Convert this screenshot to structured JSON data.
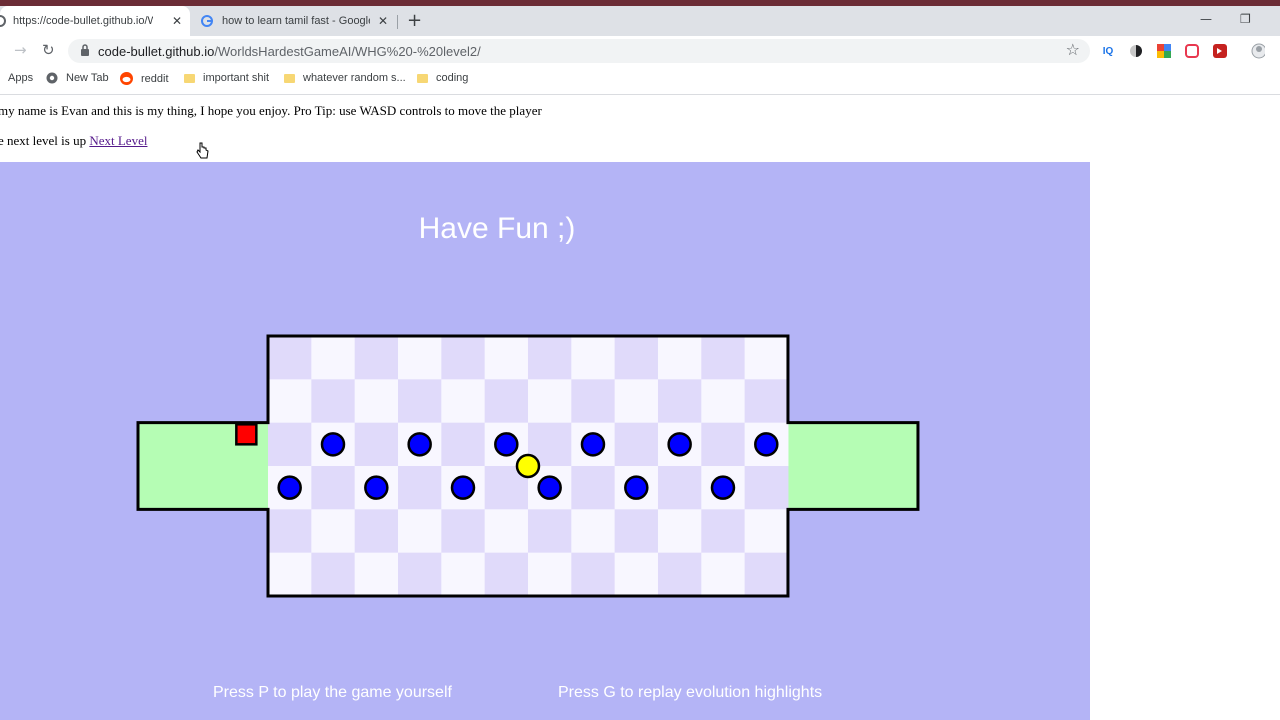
{
  "browser": {
    "tabs": [
      {
        "title": "https://code-bullet.github.io/Wo",
        "active": true
      },
      {
        "title": "how to learn tamil fast - Google",
        "active": false
      }
    ],
    "address": {
      "host": "code-bullet.github.io",
      "path": "/WorldsHardestGameAI/WHG%20-%20level2/"
    },
    "bookmarks": [
      "Apps",
      "New Tab",
      "reddit",
      "important shit",
      "whatever random s...",
      "coding"
    ],
    "extensions": [
      "IQ",
      "half-moon-icon",
      "colorful-grid-icon",
      "pocket-icon",
      "red-extension-icon",
      "profile-icon"
    ]
  },
  "page": {
    "intro": "my name is Evan and this is my thing, I hope you enjoy. Pro Tip: use WASD controls to move the player",
    "next_prefix": "e next level is up ",
    "next_link": "Next Level"
  },
  "game": {
    "headline": "Have Fun ;)",
    "hint_left": "Press P to play the game yourself",
    "hint_right": "Press G to replay evolution highlights",
    "colors": {
      "background": "#b4b4f6",
      "tile_light": "#f8f7ff",
      "tile_dark": "#e0dafa",
      "safe_zone": "#b5fdb4",
      "player": "#ff0000",
      "enemy": "#0000ff",
      "coin": "#ffff00"
    },
    "grid": {
      "cols": 12,
      "rows": 6
    },
    "safe_zones": [
      "start",
      "end"
    ],
    "player": {
      "col": -1,
      "row": 2
    },
    "enemies": [
      {
        "col": 1,
        "row": 2
      },
      {
        "col": 3,
        "row": 2
      },
      {
        "col": 5,
        "row": 2
      },
      {
        "col": 7,
        "row": 2
      },
      {
        "col": 9,
        "row": 2
      },
      {
        "col": 11,
        "row": 2
      },
      {
        "col": 0,
        "row": 3
      },
      {
        "col": 2,
        "row": 3
      },
      {
        "col": 4,
        "row": 3
      },
      {
        "col": 6,
        "row": 3
      },
      {
        "col": 8,
        "row": 3
      },
      {
        "col": 10,
        "row": 3
      }
    ],
    "coin": {
      "col": 5.5,
      "row": 2.5
    }
  }
}
